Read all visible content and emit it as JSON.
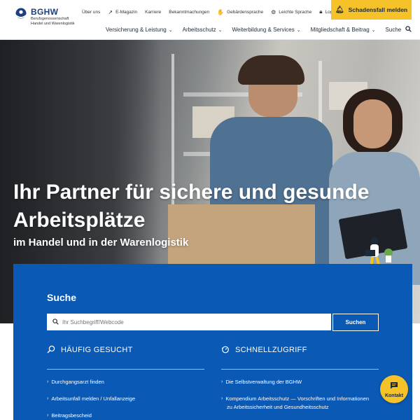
{
  "logo": {
    "name": "BGHW",
    "sub_line1": "Berufsgenossenschaft",
    "sub_line2": "Handel und Warenlogistik"
  },
  "utility_nav": [
    {
      "label": "Über uns",
      "icon": ""
    },
    {
      "label": "E-Magazin",
      "icon": "external-link-icon"
    },
    {
      "label": "Karriere",
      "icon": ""
    },
    {
      "label": "Bekanntmachungen",
      "icon": ""
    },
    {
      "label": "Gebärdensprache",
      "icon": "sign-language-icon"
    },
    {
      "label": "Leichte Sprache",
      "icon": "easy-language-icon"
    },
    {
      "label": "Login",
      "icon": "lock-icon"
    }
  ],
  "cta": {
    "label": "Schadensfall melden",
    "icon": "bell-icon"
  },
  "main_nav": [
    {
      "label": "Versicherung & Leistung"
    },
    {
      "label": "Arbeitsschutz"
    },
    {
      "label": "Weiterbildung & Services"
    },
    {
      "label": "Mitgliedschaft & Beitrag"
    }
  ],
  "nav_search": {
    "label": "Suche",
    "icon": "search-icon"
  },
  "hero": {
    "title_line1": "Ihr Partner für sichere und gesunde",
    "title_line2": "Arbeitsplätze",
    "subtitle": "im Handel und in der Warenlogistik"
  },
  "search_panel": {
    "title": "Suche",
    "placeholder": "Ihr Suchbegriff/Webcode",
    "button": "Suchen"
  },
  "frequent": {
    "heading": "HÄUFIG GESUCHT",
    "items": [
      "Durchgangsarzt finden",
      "Arbeitsunfall melden / Unfallanzeige",
      "Beitragsbescheid"
    ]
  },
  "quick": {
    "heading": "SCHNELLZUGRIFF",
    "items": [
      "Die Selbstverwaltung der BGHW",
      "Kompendium Arbeitsschutz — Vorschriften und Informationen",
      "zu Arbeitssicherheit und Gesundheitsschutz"
    ]
  },
  "kontakt": {
    "label": "Kontakt",
    "icon": "chat-icon"
  },
  "colors": {
    "brand_blue": "#0a59b4",
    "accent_yellow": "#f6c229"
  }
}
